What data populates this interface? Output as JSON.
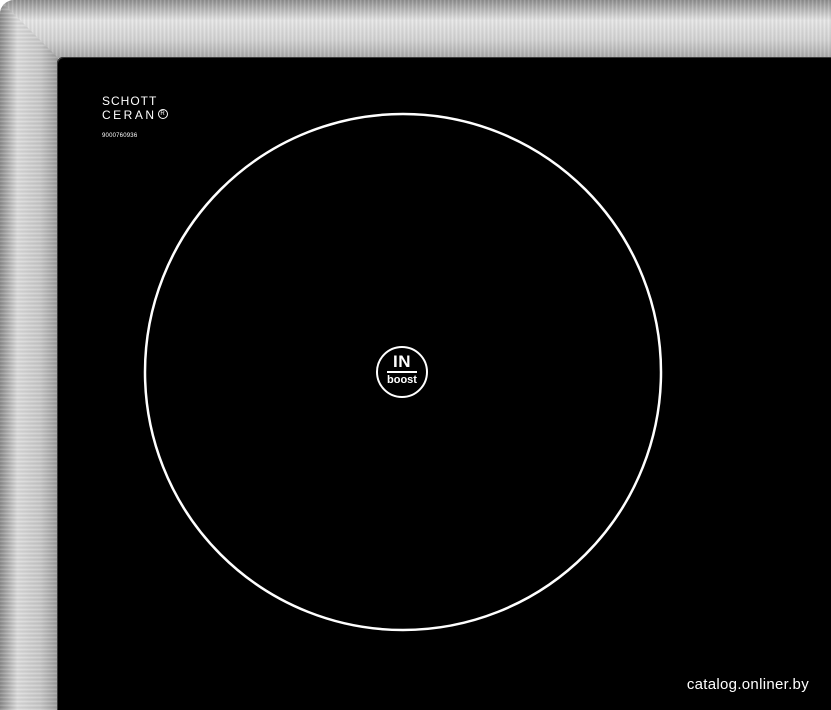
{
  "brand": {
    "line1": "SCHOTT",
    "line2": "CERAN",
    "registered_mark": "R",
    "serial": "9000760936"
  },
  "cooking_zone": {
    "badge_top": "IN",
    "badge_bottom": "boost",
    "ring_color": "#ffffff"
  },
  "watermark": "catalog.onliner.by",
  "colors": {
    "glass": "#000000",
    "steel": "#c8c8c8",
    "marking": "#ffffff"
  }
}
